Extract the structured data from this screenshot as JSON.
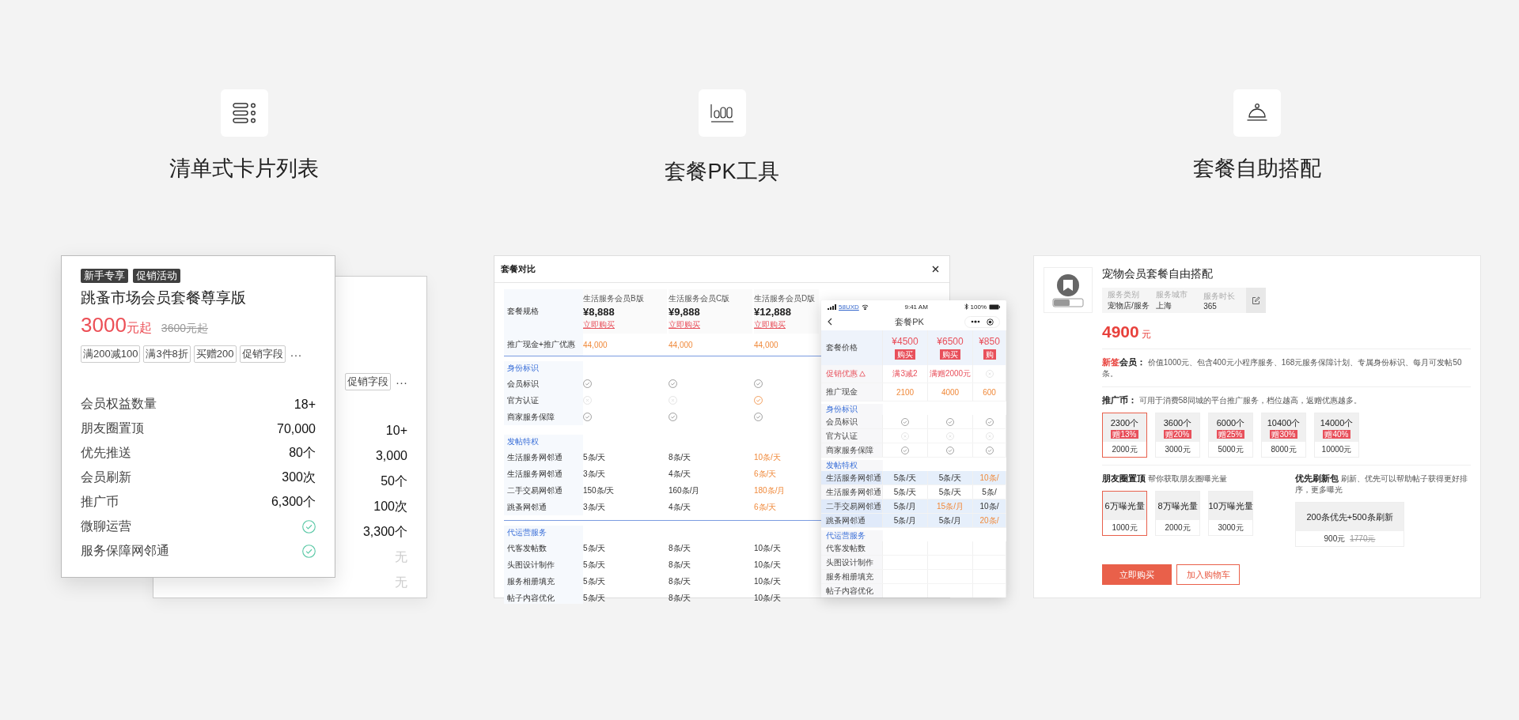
{
  "features": [
    {
      "title": "清单式卡片列表"
    },
    {
      "title": "套餐PK工具"
    },
    {
      "title": "套餐自助搭配"
    }
  ],
  "card_list": {
    "back_card": {
      "promos": [
        "促销字段"
      ],
      "more": "···",
      "values": [
        {
          "text": "10+",
          "muted": false
        },
        {
          "text": "3,000",
          "muted": false
        },
        {
          "text": "50个",
          "muted": false
        },
        {
          "text": "100次",
          "muted": false
        },
        {
          "text": "3,300个",
          "muted": false
        },
        {
          "text": "无",
          "muted": true
        },
        {
          "text": "无",
          "muted": true
        }
      ]
    },
    "front_card": {
      "badges": [
        "新手专享",
        "促销活动"
      ],
      "title": "跳蚤市场会员套餐尊享版",
      "price": "3000",
      "price_unit": "元起",
      "original_price": "3600元起",
      "promos": [
        "满200减100",
        "满3件8折",
        "买赠200",
        "促销字段"
      ],
      "more": "···",
      "rows": [
        {
          "label": "会员权益数量",
          "kind": "text",
          "value": "18+"
        },
        {
          "label": "朋友圈置顶",
          "kind": "text",
          "value": "70,000"
        },
        {
          "label": "优先推送",
          "kind": "text",
          "value": "80个"
        },
        {
          "label": "会员刷新",
          "kind": "text",
          "value": "300次"
        },
        {
          "label": "推广币",
          "kind": "text",
          "value": "6,300个"
        },
        {
          "label": "微聊运营",
          "kind": "check"
        },
        {
          "label": "服务保障网邻通",
          "kind": "check"
        }
      ]
    }
  },
  "compare": {
    "title": "套餐对比",
    "spec_label": "套餐规格",
    "plans": [
      {
        "name": "生活服务会员B版",
        "price": "¥8,888",
        "buy": "立即购买"
      },
      {
        "name": "生活服务会员C版",
        "price": "¥9,888",
        "buy": "立即购买"
      },
      {
        "name": "生活服务会员D版",
        "price": "¥12,888",
        "buy": "立即购买"
      }
    ],
    "cash_label": "推广现金+推广优惠",
    "cash": [
      "44,000",
      "44,000",
      "44,000"
    ],
    "groups": [
      {
        "title": "身份标识",
        "rows": [
          {
            "label": "会员标识",
            "cells": [
              {
                "kind": "check",
                "accent": false
              },
              {
                "kind": "check",
                "accent": false
              },
              {
                "kind": "check",
                "accent": false
              }
            ]
          },
          {
            "label": "官方认证",
            "cells": [
              {
                "kind": "none"
              },
              {
                "kind": "none"
              },
              {
                "kind": "check",
                "accent": true
              }
            ]
          },
          {
            "label": "商家服务保障",
            "cells": [
              {
                "kind": "check",
                "accent": false
              },
              {
                "kind": "check",
                "accent": false
              },
              {
                "kind": "check",
                "accent": false
              }
            ]
          }
        ]
      },
      {
        "title": "发帖特权",
        "rows": [
          {
            "label": "生活服务网邻通",
            "cells": [
              {
                "kind": "text",
                "text": "5条/天",
                "accent": false
              },
              {
                "kind": "text",
                "text": "8条/天",
                "accent": false
              },
              {
                "kind": "text",
                "text": "10条/天",
                "accent": true
              }
            ]
          },
          {
            "label": "生活服务网邻通",
            "cells": [
              {
                "kind": "text",
                "text": "3条/天",
                "accent": false
              },
              {
                "kind": "text",
                "text": "4条/天",
                "accent": false
              },
              {
                "kind": "text",
                "text": "6条/天",
                "accent": true
              }
            ]
          },
          {
            "label": "二手交易网邻通",
            "cells": [
              {
                "kind": "text",
                "text": "150条/天",
                "accent": false
              },
              {
                "kind": "text",
                "text": "160条/月",
                "accent": false
              },
              {
                "kind": "text",
                "text": "180条/月",
                "accent": true
              }
            ]
          },
          {
            "label": "跳蚤网邻通",
            "cells": [
              {
                "kind": "text",
                "text": "3条/天",
                "accent": false
              },
              {
                "kind": "text",
                "text": "4条/天",
                "accent": false
              },
              {
                "kind": "text",
                "text": "6条/天",
                "accent": true
              }
            ]
          }
        ]
      },
      {
        "title": "代运营服务",
        "rows": [
          {
            "label": "代客发帖数",
            "cells": [
              {
                "kind": "text",
                "text": "5条/天",
                "accent": false
              },
              {
                "kind": "text",
                "text": "8条/天",
                "accent": false
              },
              {
                "kind": "text",
                "text": "10条/天",
                "accent": false
              }
            ]
          },
          {
            "label": "头图设计制作",
            "cells": [
              {
                "kind": "text",
                "text": "5条/天",
                "accent": false
              },
              {
                "kind": "text",
                "text": "8条/天",
                "accent": false
              },
              {
                "kind": "text",
                "text": "10条/天",
                "accent": false
              }
            ]
          },
          {
            "label": "服务相册填充",
            "cells": [
              {
                "kind": "text",
                "text": "5条/天",
                "accent": false
              },
              {
                "kind": "text",
                "text": "8条/天",
                "accent": false
              },
              {
                "kind": "text",
                "text": "10条/天",
                "accent": false
              }
            ]
          },
          {
            "label": "帖子内容优化",
            "cells": [
              {
                "kind": "text",
                "text": "5条/天",
                "accent": false
              },
              {
                "kind": "text",
                "text": "8条/天",
                "accent": false
              },
              {
                "kind": "text",
                "text": "10条/天",
                "accent": false
              }
            ]
          }
        ]
      }
    ]
  },
  "phone": {
    "carrier": "58UXD",
    "time": "9:41 AM",
    "battery": "100%",
    "title": "套餐PK",
    "price_label": "套餐价格",
    "plans": [
      {
        "price": "¥4500",
        "buy": "购买"
      },
      {
        "price": "¥6500",
        "buy": "购买"
      },
      {
        "price": "¥850",
        "buy": "购"
      }
    ],
    "promo_label": "促销优惠",
    "promo": [
      {
        "kind": "text",
        "text": "满3减2"
      },
      {
        "kind": "text",
        "text": "满赠2000元"
      },
      {
        "kind": "none"
      }
    ],
    "cash_label": "推广现金",
    "cash": [
      "2100",
      "4000",
      "600"
    ],
    "groups": [
      {
        "title": "身份标识",
        "rows": [
          {
            "label": "会员标识",
            "highlight": false,
            "cells": [
              {
                "kind": "check",
                "accent": false
              },
              {
                "kind": "check",
                "accent": false
              },
              {
                "kind": "check",
                "accent": false
              }
            ]
          },
          {
            "label": "官方认证",
            "highlight": false,
            "cells": [
              {
                "kind": "none"
              },
              {
                "kind": "none"
              },
              {
                "kind": "none"
              }
            ]
          },
          {
            "label": "商家服务保障",
            "highlight": false,
            "cells": [
              {
                "kind": "check",
                "accent": false
              },
              {
                "kind": "check",
                "accent": false
              },
              {
                "kind": "check",
                "accent": false
              }
            ]
          }
        ]
      },
      {
        "title": "发帖特权",
        "rows": [
          {
            "label": "生活服务网邻通",
            "highlight": true,
            "cells": [
              {
                "kind": "text",
                "text": "5条/天",
                "accent": false
              },
              {
                "kind": "text",
                "text": "5条/天",
                "accent": false
              },
              {
                "kind": "text",
                "text": "10条/",
                "accent": true
              }
            ]
          },
          {
            "label": "生活服务网邻通",
            "highlight": false,
            "cells": [
              {
                "kind": "text",
                "text": "5条/天",
                "accent": false
              },
              {
                "kind": "text",
                "text": "5条/天",
                "accent": false
              },
              {
                "kind": "text",
                "text": "5条/",
                "accent": false
              }
            ]
          },
          {
            "label": "二手交易网邻通",
            "highlight": true,
            "cells": [
              {
                "kind": "text",
                "text": "5条/月",
                "accent": false
              },
              {
                "kind": "text",
                "text": "15条/月",
                "accent": true
              },
              {
                "kind": "text",
                "text": "10条/",
                "accent": false
              }
            ]
          },
          {
            "label": "跳蚤网邻通",
            "highlight": true,
            "cells": [
              {
                "kind": "text",
                "text": "5条/月",
                "accent": false
              },
              {
                "kind": "text",
                "text": "5条/月",
                "accent": false
              },
              {
                "kind": "text",
                "text": "20条/",
                "accent": true
              }
            ]
          }
        ]
      },
      {
        "title": "代运营服务",
        "rows": [
          {
            "label": "代客发帖数",
            "highlight": false
          },
          {
            "label": "头图设计制作",
            "highlight": false
          },
          {
            "label": "服务相册填充",
            "highlight": false
          },
          {
            "label": "帖子内容优化",
            "highlight": false
          }
        ]
      }
    ]
  },
  "builder": {
    "title": "宠物会员套餐自由搭配",
    "info": [
      {
        "label": "服务类别",
        "value": "宠物店/服务"
      },
      {
        "label": "服务城市",
        "value": "上海"
      },
      {
        "label": "服务时长",
        "value": "365"
      }
    ],
    "price": "4900",
    "price_unit": "元",
    "member": {
      "tag": "新签",
      "label": "会员：",
      "text": "价值1000元、包含400元小程序服务、168元服务保障计划、专属身份标识、每月可发帖50条。"
    },
    "coins": {
      "label": "推广币：",
      "text": "可用于消费58同城的平台推广服务，档位越高，返赠优惠越多。",
      "options": [
        {
          "amount": "2300个",
          "bonus": "赠13%",
          "price": "2000元",
          "selected": true
        },
        {
          "amount": "3600个",
          "bonus": "赠20%",
          "price": "3000元",
          "selected": false
        },
        {
          "amount": "6000个",
          "bonus": "赠25%",
          "price": "5000元",
          "selected": false
        },
        {
          "amount": "10400个",
          "bonus": "赠30%",
          "price": "8000元",
          "selected": false
        },
        {
          "amount": "14000个",
          "bonus": "赠40%",
          "price": "10000元",
          "selected": false
        }
      ]
    },
    "moments": {
      "label": "朋友圈置顶",
      "text": "帮你获取朋友圈曝光量",
      "options": [
        {
          "amount": "6万曝光量",
          "price": "1000元",
          "selected": true
        },
        {
          "amount": "8万曝光量",
          "price": "2000元",
          "selected": false
        },
        {
          "amount": "10万曝光量",
          "price": "3000元",
          "selected": false
        }
      ]
    },
    "refresh": {
      "label": "优先刷新包",
      "text": "刷新、优先可以帮助帖子获得更好排序，更多曝光",
      "option": {
        "amount": "200条优先+500条刷新",
        "price": "900元",
        "original_price": "1770元"
      }
    },
    "buttons": [
      {
        "label": "立即购买",
        "kind": "primary"
      },
      {
        "label": "加入购物车",
        "kind": "outline"
      }
    ]
  }
}
